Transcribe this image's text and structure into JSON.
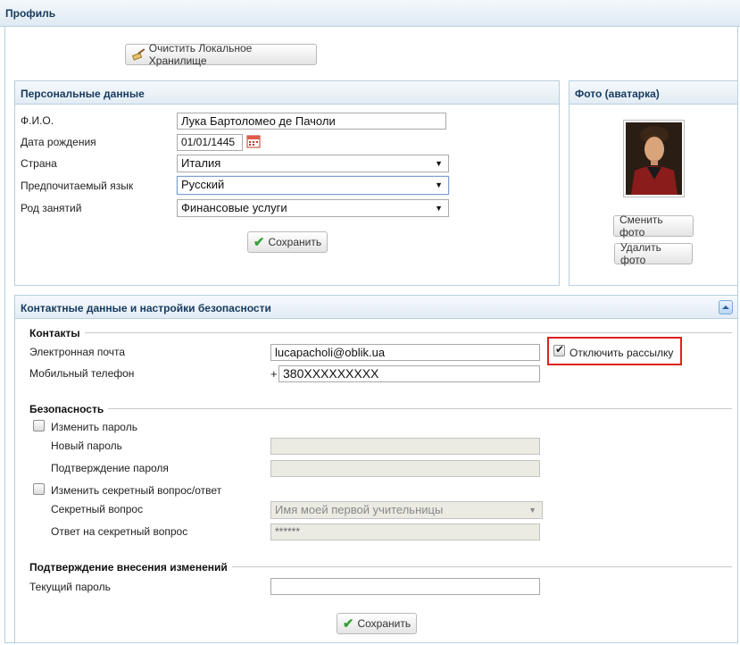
{
  "page": {
    "title": "Профиль"
  },
  "toolbar": {
    "clear_storage_label": "Очистить Локальное Хранилище"
  },
  "personal": {
    "title": "Персональные данные",
    "fio_label": "Ф.И.О.",
    "fio_value": "Лука Бартоломео де Пачоли",
    "birth_label": "Дата рождения",
    "birth_value": "01/01/1445",
    "country_label": "Страна",
    "country_value": "Италия",
    "language_label": "Предпочитаемый язык",
    "language_value": "Русский",
    "occupation_label": "Род занятий",
    "occupation_value": "Финансовые услуги",
    "save_label": "Сохранить"
  },
  "photo": {
    "title": "Фото (аватарка)",
    "change_label": "Сменить фото",
    "delete_label": "Удалить фото"
  },
  "contacts_security": {
    "title": "Контактные данные и настройки безопасности",
    "contacts_title": "Контакты",
    "email_label": "Электронная почта",
    "email_value": "lucapacholi@oblik.ua",
    "phone_label": "Мобильный телефон",
    "phone_prefix": "+",
    "phone_value": "380XXXXXXXXX",
    "unsubscribe_label": "Отключить рассылку",
    "unsubscribe_checked": true,
    "security_title": "Безопасность",
    "change_password_label": "Изменить пароль",
    "new_password_label": "Новый пароль",
    "confirm_password_label": "Подтверждение пароля",
    "change_secret_label": "Изменить секретный вопрос/ответ",
    "secret_question_label": "Секретный вопрос",
    "secret_question_value": "Имя моей первой учительницы",
    "secret_answer_label": "Ответ на секретный вопрос",
    "secret_answer_value": "******",
    "confirm_title": "Подтверждение внесения изменений",
    "current_password_label": "Текущий пароль",
    "save_label": "Сохранить"
  },
  "colors": {
    "header_text": "#173a5e",
    "border": "#b8cfe0",
    "highlight": "#e02020",
    "save_icon": "#3aa03a"
  },
  "icons": [
    "broom-icon",
    "calendar-icon",
    "check-icon",
    "collapse-icon",
    "dropdown-arrow-icon"
  ]
}
